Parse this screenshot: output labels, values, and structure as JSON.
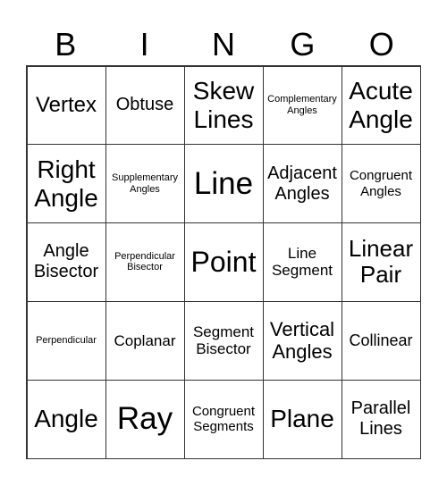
{
  "header": [
    "B",
    "I",
    "N",
    "G",
    "O"
  ],
  "cells": [
    "Vertex",
    "Obtuse",
    "Skew Lines",
    "Complementary Angles",
    "Acute Angle",
    "Right Angle",
    "Supplementary Angles",
    "Line",
    "Adjacent Angles",
    "Congruent Angles",
    "Angle Bisector",
    "Perpendicular Bisector",
    "Point",
    "Line Segment",
    "Linear Pair",
    "Perpendicular",
    "Coplanar",
    "Segment Bisector",
    "Vertical Angles",
    "Collinear",
    "Angle",
    "Ray",
    "Congruent Segments",
    "Plane",
    "Parallel Lines"
  ]
}
